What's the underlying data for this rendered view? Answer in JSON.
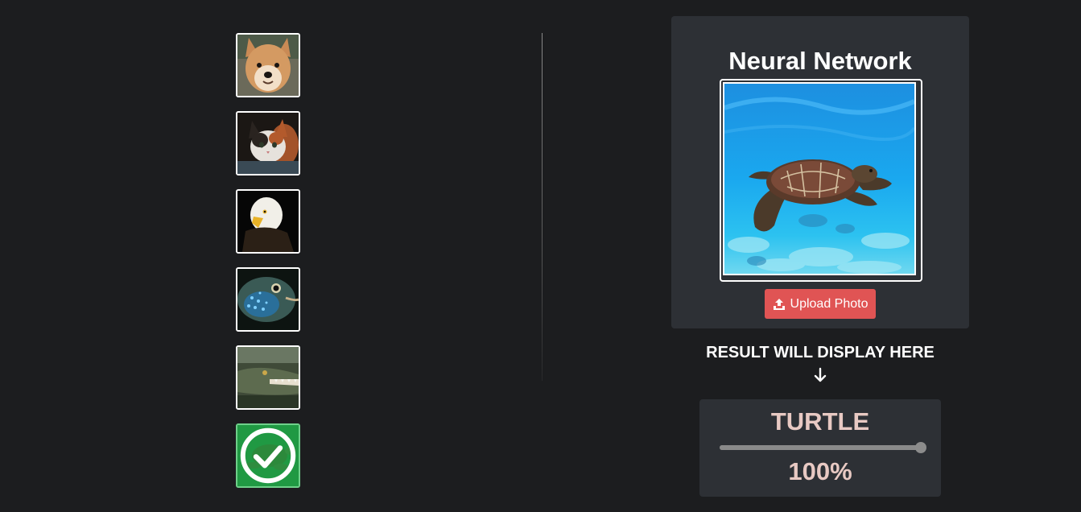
{
  "samples": [
    {
      "animal": "dog",
      "icon": "dog-photo"
    },
    {
      "animal": "cat",
      "icon": "cat-photo"
    },
    {
      "animal": "eagle",
      "icon": "eagle-photo"
    },
    {
      "animal": "fish",
      "icon": "fish-photo"
    },
    {
      "animal": "crocodile",
      "icon": "crocodile-photo"
    },
    {
      "animal": "turtle",
      "icon": "turtle-photo",
      "selected": true
    }
  ],
  "panel": {
    "title": "Neural Network",
    "upload_label": "Upload Photo",
    "preview_icon": "sea-turtle-photo"
  },
  "result": {
    "heading": "RESULT WILL DISPLAY HERE",
    "label": "TURTLE",
    "confidence": 1.0,
    "confidence_text": "100%"
  },
  "colors": {
    "background": "#1c1d1f",
    "card": "#2d3035",
    "upload_button": "#e05454",
    "selected_overlay": "#19963c",
    "result_text": "#e8c9c3"
  }
}
